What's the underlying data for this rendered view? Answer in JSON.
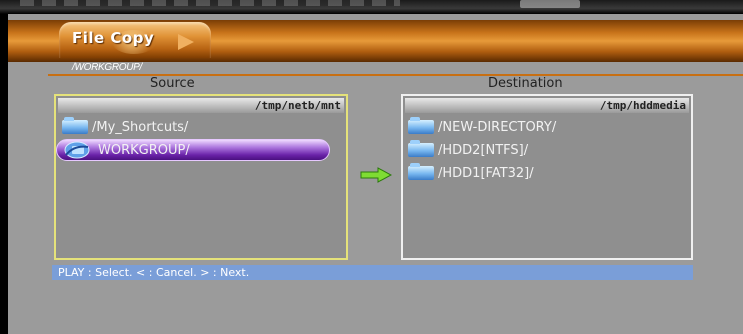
{
  "header": {
    "title": "File Copy",
    "current_path": "/WORKGROUP/"
  },
  "source": {
    "label": "Source",
    "path": "/tmp/netb/mnt",
    "items": [
      {
        "label": "/My_Shortcuts/",
        "selected": false
      },
      {
        "label": "WORKGROUP/",
        "selected": true
      }
    ]
  },
  "destination": {
    "label": "Destination",
    "path": "/tmp/hddmedia",
    "items": [
      {
        "label": "/NEW-DIRECTORY/"
      },
      {
        "label": "/HDD2[NTFS]/"
      },
      {
        "label": "/HDD1[FAT32]/"
      }
    ]
  },
  "status": {
    "text": "PLAY : Select.  < : Cancel.  > : Next."
  },
  "colors": {
    "accent": "#c8731a",
    "selection": "#7a3cc0",
    "status_bar": "#7a9ed8",
    "source_border": "#e5e27a"
  },
  "icons": {
    "folder": "folder-icon",
    "transfer": "arrow-right-icon",
    "network": "network-folder-icon"
  }
}
